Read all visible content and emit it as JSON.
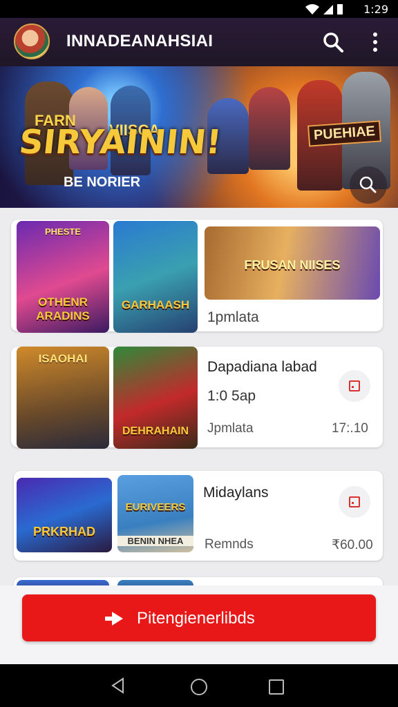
{
  "status_bar": {
    "time": "1:29"
  },
  "app_bar": {
    "title": "INNADEANAHSIAI"
  },
  "hero": {
    "title": "SIRYAININ!",
    "small_text_left": "FARN",
    "small_text_right": "VIISCA",
    "subtitle": "BE NORIER",
    "right_logo": "PUEHIAE"
  },
  "cards": [
    {
      "thumb1": {
        "top": "PHESTE",
        "label": "OTHENR ARADINS"
      },
      "thumb2": {
        "label": "GARHAASH"
      },
      "thumb3": {
        "label": "FRUSAN NIISES"
      },
      "line1": "1pmlata"
    },
    {
      "thumb1": {
        "top": "ISAOHAI",
        "label": ""
      },
      "thumb2": {
        "label": "DEHRAHAIN"
      },
      "title": "Dapadiana labad",
      "line2": "1:0 5ap",
      "sub": "Jpmlata",
      "price": "17:.10"
    },
    {
      "thumb1": {
        "label": "PRKRHAD"
      },
      "thumb2": {
        "label": "EURIVEERS",
        "bottom": "BENIN NHEA"
      },
      "title": "Midaylans",
      "sub": "Remnds",
      "price": "₹60.00"
    }
  ],
  "cta": {
    "label": "Pitengienerlibds"
  }
}
